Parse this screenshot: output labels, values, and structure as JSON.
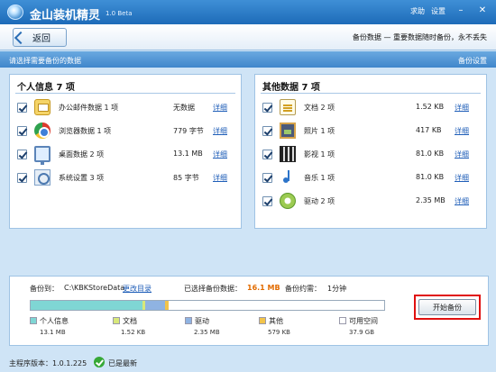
{
  "app": {
    "title": "金山装机精灵",
    "version": "1.0 Beta",
    "link_help": "求助",
    "link_settings": "设置"
  },
  "header": {
    "back_label": "返回",
    "slogan": "备份数据 — 重要数据随时备份，永不丢失"
  },
  "subbar": {
    "prompt": "请选择需要备份的数据",
    "backup_settings": "备份设置"
  },
  "personal": {
    "title": "个人信息  7 项",
    "detail_label": "详细",
    "items": [
      {
        "name": "办公邮件数据 1 项",
        "size": "无数据",
        "icon": "mail-icon"
      },
      {
        "name": "浏览器数据 1 项",
        "size": "779 字节",
        "icon": "chrome-icon"
      },
      {
        "name": "桌面数据 2 项",
        "size": "13.1 MB",
        "icon": "desktop-icon"
      },
      {
        "name": "系统设置 3 项",
        "size": "85 字节",
        "icon": "settings-icon"
      }
    ]
  },
  "other": {
    "title": "其他数据  7 项",
    "detail_label": "详细",
    "items": [
      {
        "name": "文档 2 项",
        "size": "1.52 KB",
        "icon": "document-icon"
      },
      {
        "name": "照片 1 项",
        "size": "417 KB",
        "icon": "photo-icon"
      },
      {
        "name": "影视 1 项",
        "size": "81.0 KB",
        "icon": "video-icon"
      },
      {
        "name": "音乐 1 项",
        "size": "81.0 KB",
        "icon": "music-icon"
      },
      {
        "name": "驱动 2 项",
        "size": "2.35 MB",
        "icon": "driver-icon"
      }
    ]
  },
  "backup": {
    "to_label": "备份到：",
    "path": "C:\\KBKStoreData",
    "change_dir": "更改目录",
    "selected_label": "已选择备份数据：",
    "selected_value": "16.1 MB",
    "estimate_label": "备份约需：",
    "estimate_value": "1分钟",
    "start_button": "开始备份",
    "usage": [
      {
        "label": "个人信息",
        "value": "13.1 MB",
        "color": "#7fd6d4"
      },
      {
        "label": "文档",
        "value": "1.52 KB",
        "color": "#d8e87a"
      },
      {
        "label": "驱动",
        "value": "2.35 MB",
        "color": "#8fb3e2"
      },
      {
        "label": "其他",
        "value": "579 KB",
        "color": "#f2c44b"
      },
      {
        "label": "可用空间",
        "value": "37.9 GB",
        "color": "#ffffff"
      }
    ]
  },
  "status": {
    "version_text": "主程序版本：1.0.1.225",
    "latest": "已是最新"
  }
}
